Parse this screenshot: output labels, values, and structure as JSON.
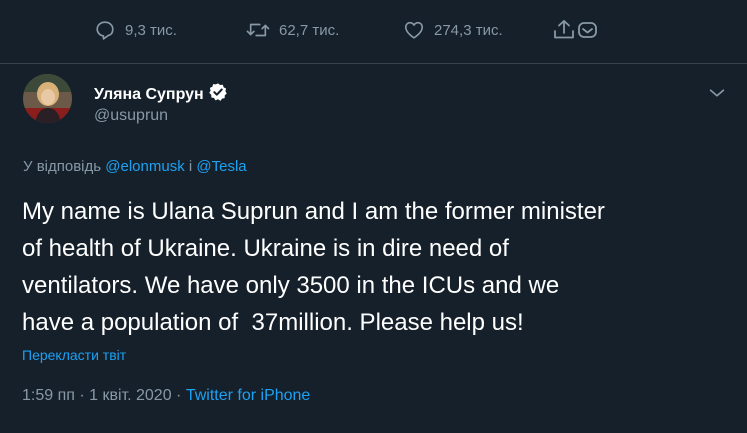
{
  "actions": {
    "replies": "9,3 тис.",
    "retweets": "62,7 тис.",
    "likes": "274,3 тис."
  },
  "author": {
    "name": "Уляна Супрун",
    "handle": "@usuprun",
    "verified": true
  },
  "reply_context": {
    "prefix": "У відповідь",
    "mention1": "@elonmusk",
    "joiner": "і",
    "mention2": "@Tesla"
  },
  "tweet": {
    "lines": [
      "My name is Ulana Suprun and I am the former minister",
      "of health of Ukraine. Ukraine is in dire need of",
      "ventilators. We have only 3500 in the ICUs and we",
      "have a population of  37million. Please help us!"
    ],
    "translate_label": "Перекласти твіт"
  },
  "meta": {
    "time": "1:59 пп",
    "date": "1 квіт. 2020",
    "separator": "·",
    "source": "Twitter for iPhone"
  },
  "colors": {
    "background": "#15202b",
    "text_primary": "#ffffff",
    "text_secondary": "#8899a6",
    "link": "#1da1f2",
    "divider": "#38444d"
  },
  "icons": {
    "reply": "reply-icon",
    "retweet": "retweet-icon",
    "like": "heart-icon",
    "share": "share-icon",
    "verified": "verified-badge-icon",
    "more": "chevron-down-icon"
  }
}
